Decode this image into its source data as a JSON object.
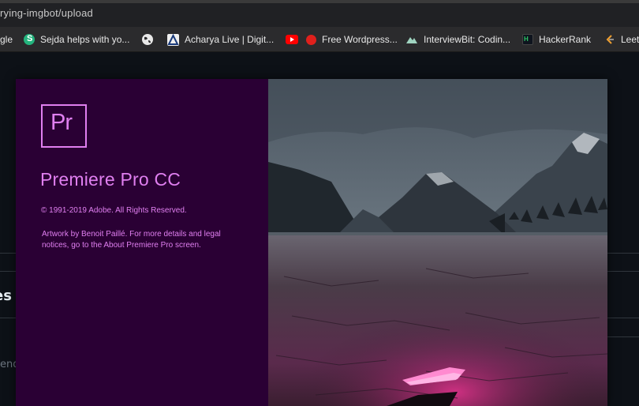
{
  "browser": {
    "url_visible": "rying-imgbot/upload",
    "bookmarks": [
      {
        "label": "gle",
        "icon": "google-icon"
      },
      {
        "label": "Sejda helps with yo...",
        "icon": "sejda-icon"
      },
      {
        "label": "",
        "icon": "globe-icon"
      },
      {
        "label": "Acharya Live | Digit...",
        "icon": "acharya-icon"
      },
      {
        "label": "",
        "icon": "youtube-icon"
      },
      {
        "label": "Free Wordpress...",
        "icon": "red-dot-icon"
      },
      {
        "label": "InterviewBit: Codin...",
        "icon": "interviewbit-icon"
      },
      {
        "label": "HackerRank",
        "icon": "hackerrank-icon"
      },
      {
        "label": "Leet",
        "icon": "leetcode-icon"
      }
    ]
  },
  "page": {
    "heading_fragment": "es",
    "text_fragment": "ende"
  },
  "splash": {
    "logo_text": "Pr",
    "app_name": "Premiere Pro CC",
    "copyright": "© 1991-2019 Adobe. All Rights Reserved.",
    "credits": "Artwork by Benoit Paillé. For more details and legal notices, go to the About Premiere Pro screen.",
    "colors": {
      "panel": "#2a0034",
      "accent": "#e07ff0"
    }
  }
}
